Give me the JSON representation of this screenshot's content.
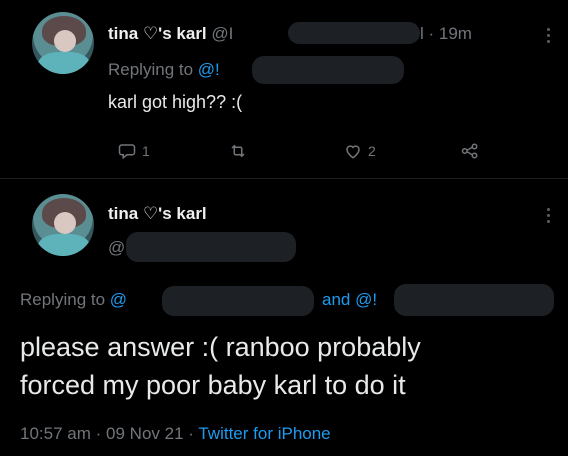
{
  "reply_tweet": {
    "display_name": "tina ♡'s karl",
    "handle_prefix": "@I",
    "handle_suffix": "l",
    "time": "· 19m",
    "replying_to_label": "Replying to",
    "replying_to_handle": "@!",
    "text": "karl got high?? :(",
    "actions": {
      "reply_count": "1",
      "retweet_count": "",
      "like_count": "2"
    }
  },
  "main_tweet": {
    "display_name": "tina ♡'s karl",
    "handle_prefix": "@",
    "replying_to_label": "Replying to",
    "replying_to_handle_1": "@",
    "and_label": "and",
    "replying_to_handle_2": "@!",
    "text_line1": "please answer :( ranboo probably",
    "text_line2": "forced my poor baby karl to do it",
    "time": "10:57 am",
    "date": "09 Nov 21",
    "source": "Twitter for iPhone",
    "separator": "·"
  },
  "icons": [
    "reply-icon",
    "retweet-icon",
    "heart-icon",
    "share-icon",
    "more-dots-icon"
  ],
  "colors": {
    "background": "#000000",
    "text": "#e7e9ea",
    "muted": "#71767b",
    "accent": "#1d9bf0"
  }
}
